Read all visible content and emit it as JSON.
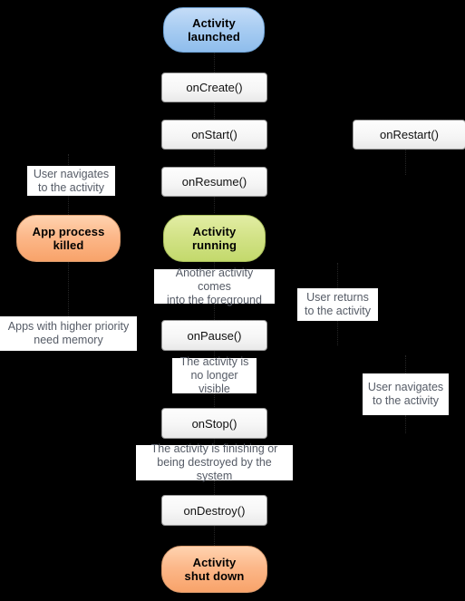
{
  "diagram": {
    "title": "Android Activity Lifecycle",
    "background_color": "#000000",
    "colors": {
      "state_launched": "#a9cdf2",
      "state_running": "#d3e388",
      "state_killed": "#fcb88a",
      "state_shutdown": "#fcb88a",
      "method_box": "#f6f6f6",
      "note_box": "#ffffff",
      "note_text": "#555b66",
      "connector": "#262626"
    }
  },
  "states": [
    {
      "id": "activity-launched",
      "label_line1": "Activity",
      "label_line2": "launched",
      "color": "#a9cdf2"
    },
    {
      "id": "app-process-killed",
      "label_line1": "App process",
      "label_line2": "killed",
      "color": "#fcb88a"
    },
    {
      "id": "activity-running",
      "label_line1": "Activity",
      "label_line2": "running",
      "color": "#d3e388"
    },
    {
      "id": "activity-shut-down",
      "label_line1": "Activity",
      "label_line2": "shut down",
      "color": "#fcb88a"
    }
  ],
  "methods": [
    {
      "id": "on-create",
      "label": "onCreate()"
    },
    {
      "id": "on-start",
      "label": "onStart()"
    },
    {
      "id": "on-restart",
      "label": "onRestart()"
    },
    {
      "id": "on-resume",
      "label": "onResume()"
    },
    {
      "id": "on-pause",
      "label": "onPause()"
    },
    {
      "id": "on-stop",
      "label": "onStop()"
    },
    {
      "id": "on-destroy",
      "label": "onDestroy()"
    }
  ],
  "notes": [
    {
      "id": "user-navigates-left",
      "line1": "User navigates",
      "line2": "to the activity"
    },
    {
      "id": "another-activity-foreground",
      "line1": "Another activity comes",
      "line2": "into the foreground"
    },
    {
      "id": "user-returns",
      "line1": "User returns",
      "line2": "to the activity"
    },
    {
      "id": "apps-higher-priority",
      "line1": "Apps with higher priority",
      "line2": "need memory"
    },
    {
      "id": "no-longer-visible",
      "line1": "The activity is",
      "line2": "no longer visible"
    },
    {
      "id": "user-navigates-right",
      "line1": "User navigates",
      "line2": "to the activity"
    },
    {
      "id": "activity-finishing",
      "line1": "The activity is finishing or",
      "line2": "being destroyed by the system"
    }
  ]
}
